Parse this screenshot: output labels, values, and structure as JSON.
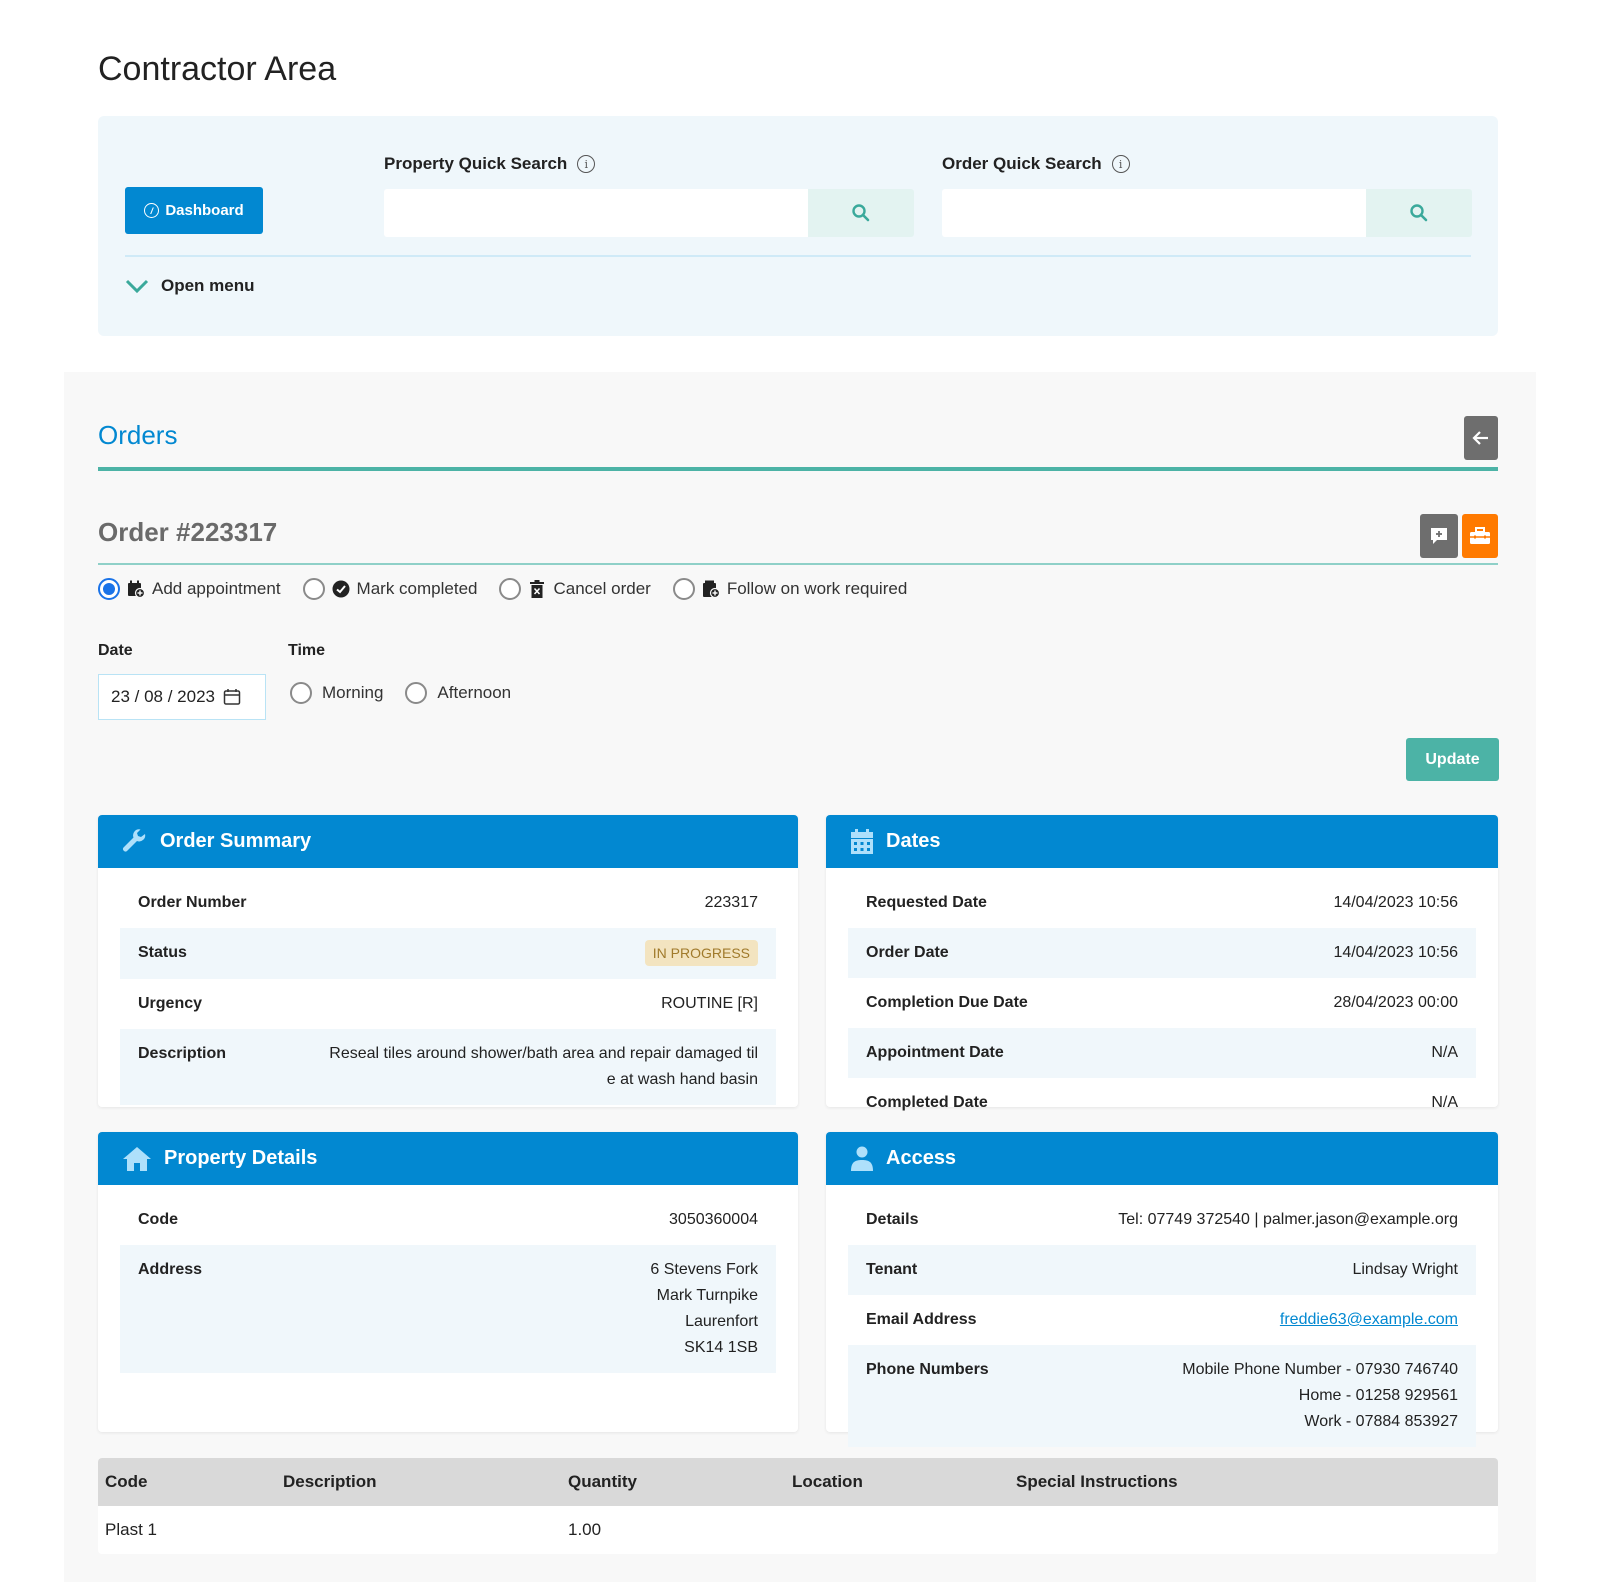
{
  "page": {
    "title": "Contractor Area"
  },
  "top_panel": {
    "dashboard_label": "Dashboard",
    "property_search": {
      "label": "Property Quick Search",
      "value": "",
      "placeholder": ""
    },
    "order_search": {
      "label": "Order Quick Search",
      "value": "",
      "placeholder": ""
    },
    "open_menu_label": "Open menu"
  },
  "orders": {
    "section_title": "Orders",
    "order_heading": "Order #223317",
    "actions": [
      {
        "label": "Add appointment",
        "selected": true,
        "icon": "calendar-plus-icon"
      },
      {
        "label": "Mark completed",
        "selected": false,
        "icon": "check-circle-icon"
      },
      {
        "label": "Cancel order",
        "selected": false,
        "icon": "trash-x-icon"
      },
      {
        "label": "Follow on work required",
        "selected": false,
        "icon": "clipboard-plus-icon"
      }
    ],
    "date_label": "Date",
    "date_value": "23 / 08 / 2023",
    "time_label": "Time",
    "time_options": [
      {
        "label": "Morning",
        "selected": false
      },
      {
        "label": "Afternoon",
        "selected": false
      }
    ],
    "update_label": "Update"
  },
  "order_summary": {
    "title": "Order Summary",
    "rows": [
      {
        "key": "Order Number",
        "value": "223317"
      },
      {
        "key": "Status",
        "value": "IN PROGRESS"
      },
      {
        "key": "Urgency",
        "value": "ROUTINE [R]"
      },
      {
        "key": "Description",
        "value": "Reseal tiles around shower/bath area and repair damaged tile at wash hand basin"
      }
    ]
  },
  "dates": {
    "title": "Dates",
    "rows": [
      {
        "key": "Requested Date",
        "value": "14/04/2023 10:56"
      },
      {
        "key": "Order Date",
        "value": "14/04/2023 10:56"
      },
      {
        "key": "Completion Due Date",
        "value": "28/04/2023 00:00"
      },
      {
        "key": "Appointment Date",
        "value": "N/A"
      },
      {
        "key": "Completed Date",
        "value": "N/A"
      }
    ]
  },
  "property_details": {
    "title": "Property Details",
    "rows": [
      {
        "key": "Code",
        "value": "3050360004"
      },
      {
        "key": "Address",
        "lines": [
          "6 Stevens Fork",
          "Mark Turnpike",
          "Laurenfort",
          "SK14 1SB"
        ]
      }
    ]
  },
  "access": {
    "title": "Access",
    "rows": [
      {
        "key": "Details",
        "value": "Tel: 07749 372540 | palmer.jason@example.org"
      },
      {
        "key": "Tenant",
        "value": "Lindsay Wright"
      },
      {
        "key": "Email Address",
        "value": "freddie63@example.com"
      },
      {
        "key": "Phone Numbers",
        "lines": [
          "Mobile Phone Number - 07930 746740",
          "Home - 01258 929561",
          "Work - 07884 853927"
        ]
      }
    ]
  },
  "items_table": {
    "columns": [
      "Code",
      "Description",
      "Quantity",
      "Location",
      "Special Instructions"
    ],
    "rows": [
      [
        "Plast 1",
        "",
        "1.00",
        "",
        ""
      ]
    ]
  },
  "colors": {
    "primary": "#0288d1",
    "teal": "#4cb3a6",
    "orange": "#ff7a00",
    "status_badge_bg": "#f3e4c0",
    "status_badge_text": "#a07a2b"
  }
}
